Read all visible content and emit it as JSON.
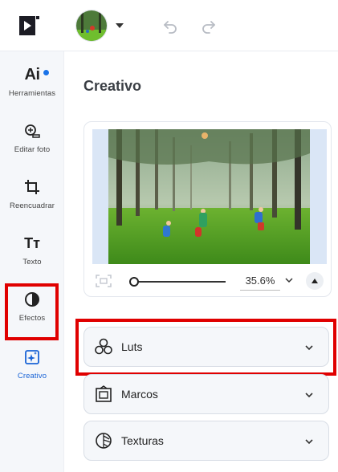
{
  "topbar": {
    "logo": "play-logo-icon",
    "avatar": "avatar-icon",
    "undo": "undo-icon",
    "redo": "redo-icon"
  },
  "sidebar": {
    "items": [
      {
        "label": "Herramientas",
        "icon": "ai-icon",
        "badge": true
      },
      {
        "label": "Editar foto",
        "icon": "edit-photo-icon"
      },
      {
        "label": "Reencuadrar",
        "icon": "crop-icon"
      },
      {
        "label": "Texto",
        "icon": "text-icon"
      },
      {
        "label": "Efectos",
        "icon": "contrast-icon"
      },
      {
        "label": "Creativo",
        "icon": "sparkle-icon",
        "active": true
      }
    ],
    "ai_glyph": "Ai",
    "text_glyph": "Tт"
  },
  "main": {
    "title": "Creativo",
    "preview": {
      "zoom_value": "35.6%",
      "zoom_slider_fraction": 0.0
    },
    "accordions": [
      {
        "label": "Luts",
        "icon": "luts-icon",
        "highlighted": true
      },
      {
        "label": "Marcos",
        "icon": "frame-icon"
      },
      {
        "label": "Texturas",
        "icon": "texture-icon"
      }
    ]
  },
  "colors": {
    "accent": "#1a64d6",
    "highlight": "#e00000",
    "badge": "#1a73e8"
  }
}
